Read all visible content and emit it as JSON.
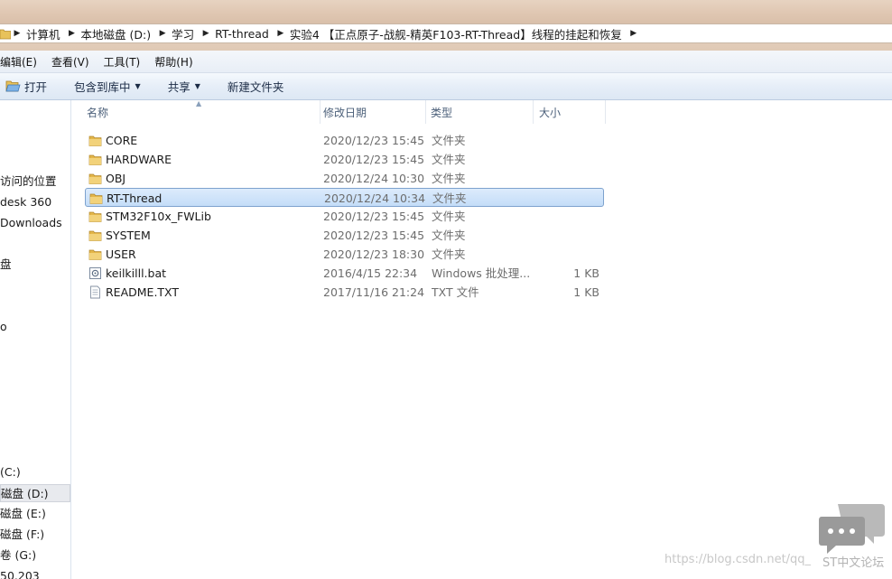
{
  "breadcrumb": [
    "计算机",
    "本地磁盘 (D:)",
    "学习",
    "RT-thread",
    "实验4 【正点原子-战舰-精英F103-RT-Thread】线程的挂起和恢复"
  ],
  "menu": [
    "编辑(E)",
    "查看(V)",
    "工具(T)",
    "帮助(H)"
  ],
  "toolbar": {
    "open": "打开",
    "include_library": "包含到库中",
    "share": "共享",
    "new_folder": "新建文件夹"
  },
  "columns": {
    "name": "名称",
    "date": "修改日期",
    "type": "类型",
    "size": "大小"
  },
  "files": [
    {
      "name": "CORE",
      "date": "2020/12/23 15:45",
      "type": "文件夹",
      "size": "",
      "icon": "folder-icon"
    },
    {
      "name": "HARDWARE",
      "date": "2020/12/23 15:45",
      "type": "文件夹",
      "size": "",
      "icon": "folder-icon"
    },
    {
      "name": "OBJ",
      "date": "2020/12/24 10:30",
      "type": "文件夹",
      "size": "",
      "icon": "folder-icon"
    },
    {
      "name": "RT-Thread",
      "date": "2020/12/24 10:34",
      "type": "文件夹",
      "size": "",
      "icon": "folder-icon",
      "selected": true
    },
    {
      "name": "STM32F10x_FWLib",
      "date": "2020/12/23 15:45",
      "type": "文件夹",
      "size": "",
      "icon": "folder-icon"
    },
    {
      "name": "SYSTEM",
      "date": "2020/12/23 15:45",
      "type": "文件夹",
      "size": "",
      "icon": "folder-icon"
    },
    {
      "name": "USER",
      "date": "2020/12/23 18:30",
      "type": "文件夹",
      "size": "",
      "icon": "folder-icon"
    },
    {
      "name": "keilkilll.bat",
      "date": "2016/4/15 22:34",
      "type": "Windows 批处理...",
      "size": "1 KB",
      "icon": "batch-file-icon"
    },
    {
      "name": "README.TXT",
      "date": "2017/11/16 21:24",
      "type": "TXT 文件",
      "size": "1 KB",
      "icon": "text-file-icon"
    }
  ],
  "nav": [
    {
      "label": "访问的位置"
    },
    {
      "label": "desk 360"
    },
    {
      "label": "Downloads"
    },
    {
      "label": "盘"
    },
    {
      "label": "o"
    },
    {
      "label": "(C:)"
    },
    {
      "label": "磁盘 (D:)",
      "selected": true
    },
    {
      "label": "磁盘 (E:)"
    },
    {
      "label": "磁盘 (F:)"
    },
    {
      "label": "卷 (G:)"
    },
    {
      "label": "50.203"
    }
  ],
  "watermark": {
    "url": "https://blog.csdn.net/qq_",
    "brand": "ST中文论坛"
  },
  "colors": {
    "selection_bg": "#cde3fb",
    "selection_border": "#7da2ce",
    "folder": "#e8c25a",
    "toolbar_text": "#1b2b45"
  }
}
